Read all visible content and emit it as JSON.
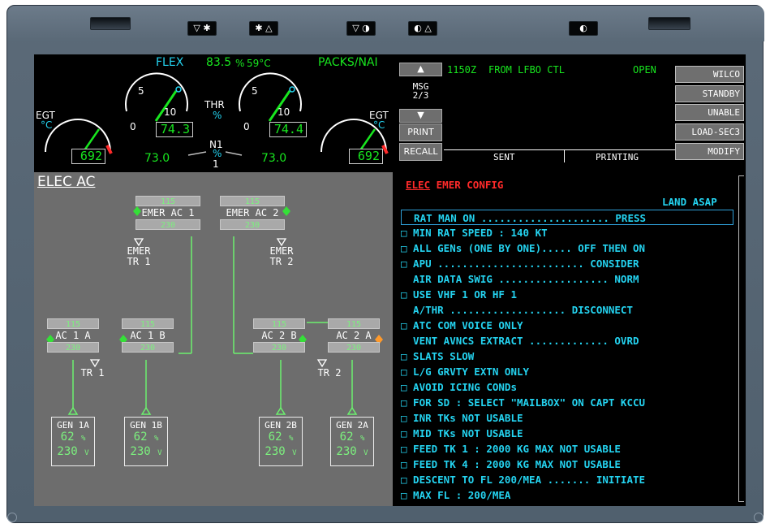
{
  "bezel": {
    "keys": [
      {
        "id": "k1",
        "label": "▽ ✱"
      },
      {
        "id": "k2",
        "label": "✱ △"
      },
      {
        "id": "k3",
        "label": "▽ ◑"
      },
      {
        "id": "k4",
        "label": "◐ △"
      },
      {
        "id": "k5",
        "label": "◐"
      }
    ]
  },
  "engine": {
    "flex_label": "FLEX",
    "flex_value": "83.5",
    "flex_unit": "%",
    "flex_temp": "59°C",
    "packs": "PACKS/NAI",
    "thr_label": "THR",
    "thr_unit": "%",
    "n1_label": "N1",
    "n1_unit": "%",
    "egt_label": "EGT",
    "egt_unit": "°C",
    "gauge_ticks": [
      "5",
      "10",
      "0"
    ],
    "thr1": "74.3",
    "thr2": "74.4",
    "n1_1": "73.0",
    "n1_2": "73.0",
    "n1_marker": "1",
    "egt1": "692",
    "egt2": "692"
  },
  "elec": {
    "title": "ELEC AC",
    "emer_ac1": {
      "top": "115",
      "name": "EMER AC 1",
      "bottom": "230"
    },
    "emer_ac2": {
      "top": "115",
      "name": "EMER AC 2",
      "bottom": "230"
    },
    "emer_tr1": [
      "EMER",
      "TR 1"
    ],
    "emer_tr2": [
      "EMER",
      "TR 2"
    ],
    "ac1a": {
      "top": "115",
      "name": "AC 1 A",
      "bottom": "230"
    },
    "ac1b": {
      "top": "115",
      "name": "AC 1 B",
      "bottom": "230"
    },
    "ac2b": {
      "top": "115",
      "name": "AC 2 B",
      "bottom": "230"
    },
    "ac2a": {
      "top": "115",
      "name": "AC 2 A",
      "bottom": "230"
    },
    "tr1": "TR 1",
    "tr2": "TR 2",
    "gens": [
      {
        "name": "GEN 1A",
        "pct": "62",
        "pct_unit": "%",
        "volt": "230",
        "volt_unit": "V"
      },
      {
        "name": "GEN 1B",
        "pct": "62",
        "pct_unit": "%",
        "volt": "230",
        "volt_unit": "V"
      },
      {
        "name": "GEN 2B",
        "pct": "62",
        "pct_unit": "%",
        "volt": "230",
        "volt_unit": "V"
      },
      {
        "name": "GEN 2A",
        "pct": "62",
        "pct_unit": "%",
        "volt": "230",
        "volt_unit": "V"
      }
    ]
  },
  "dcdu": {
    "msg_time": "1150Z",
    "msg_from": "FROM LFBO CTL",
    "msg_status": "OPEN",
    "msg_label": "MSG",
    "msg_page": "2/3",
    "print": "PRINT",
    "recall": "RECALL",
    "sent": "SENT",
    "printing": "PRINTING",
    "right_buttons": [
      "WILCO",
      "STANDBY",
      "UNABLE",
      "LOAD-SEC3",
      "MODIFY"
    ]
  },
  "ecam": {
    "title_sys": "ELEC",
    "title_rest": "EMER CONFIG",
    "land": "LAND ASAP",
    "lines": [
      "  RAT MAN ON ..................... PRESS",
      "□ MIN RAT SPEED : 140 KT",
      "□ ALL GENs (ONE BY ONE)..... OFF THEN ON",
      "□ APU ........................ CONSIDER",
      "  AIR DATA SWIG .................. NORM",
      "□ USE VHF 1 OR HF 1",
      "  A/THR ................... DISCONNECT",
      "□ ATC COM VOICE ONLY",
      "  VENT AVNCS EXTRACT ............. OVRD",
      "□ SLATS SLOW",
      "□ L/G GRVTY EXTN ONLY",
      "□ AVOID ICING CONDs",
      "□ FOR SD : SELECT \"MAILBOX\" ON CAPT KCCU",
      "□ INR TKs NOT USABLE",
      "□ MID TKs NOT USABLE",
      "□ FEED TK 1 : 2000 KG MAX NOT USABLE",
      "□ FEED TK 4 : 2000 KG MAX NOT USABLE",
      "□ DESCENT TO FL 200/MEA ....... INITIATE",
      "□ MAX FL : 200/MEA"
    ]
  },
  "colors": {
    "green": "#18e61f",
    "cyan": "#24d3f0",
    "red": "#ff2a2a",
    "amber": "#ff9a2c",
    "bezel": "#5b6a78"
  }
}
